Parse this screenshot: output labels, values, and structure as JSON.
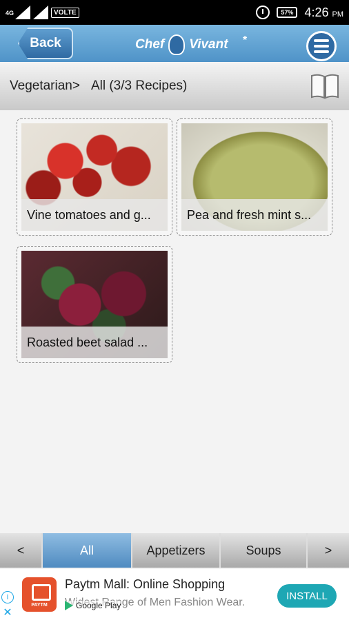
{
  "status_bar": {
    "network": "4G",
    "volte": "VOLTE",
    "battery": "57%",
    "time": "4:26",
    "ampm": "PM"
  },
  "header": {
    "back_label": "Back",
    "logo_text_left": "Chef",
    "logo_text_right": "Vivant",
    "star": "*"
  },
  "breadcrumb": {
    "category": "Vegetarian>",
    "filter": "All (3/3 Recipes)"
  },
  "recipes": [
    {
      "title": "Vine tomatoes and g..."
    },
    {
      "title": "Pea and fresh mint s..."
    },
    {
      "title": "Roasted beet salad ..."
    }
  ],
  "tabs": {
    "prev": "<",
    "items": [
      "All",
      "Appetizers",
      "Soups"
    ],
    "next": ">"
  },
  "ad": {
    "app_badge": "PAYTM",
    "title": "Paytm Mall: Online Shopping",
    "subtitle": "Widest Range of Men Fashion Wear.",
    "store": "Google Play",
    "install_label": "INSTALL",
    "info_icon": "i",
    "close_icon": "✕"
  },
  "colors": {
    "header_blue": "#4f93c8",
    "active_tab": "#4f8bc0",
    "install_button": "#1ea7b4"
  }
}
